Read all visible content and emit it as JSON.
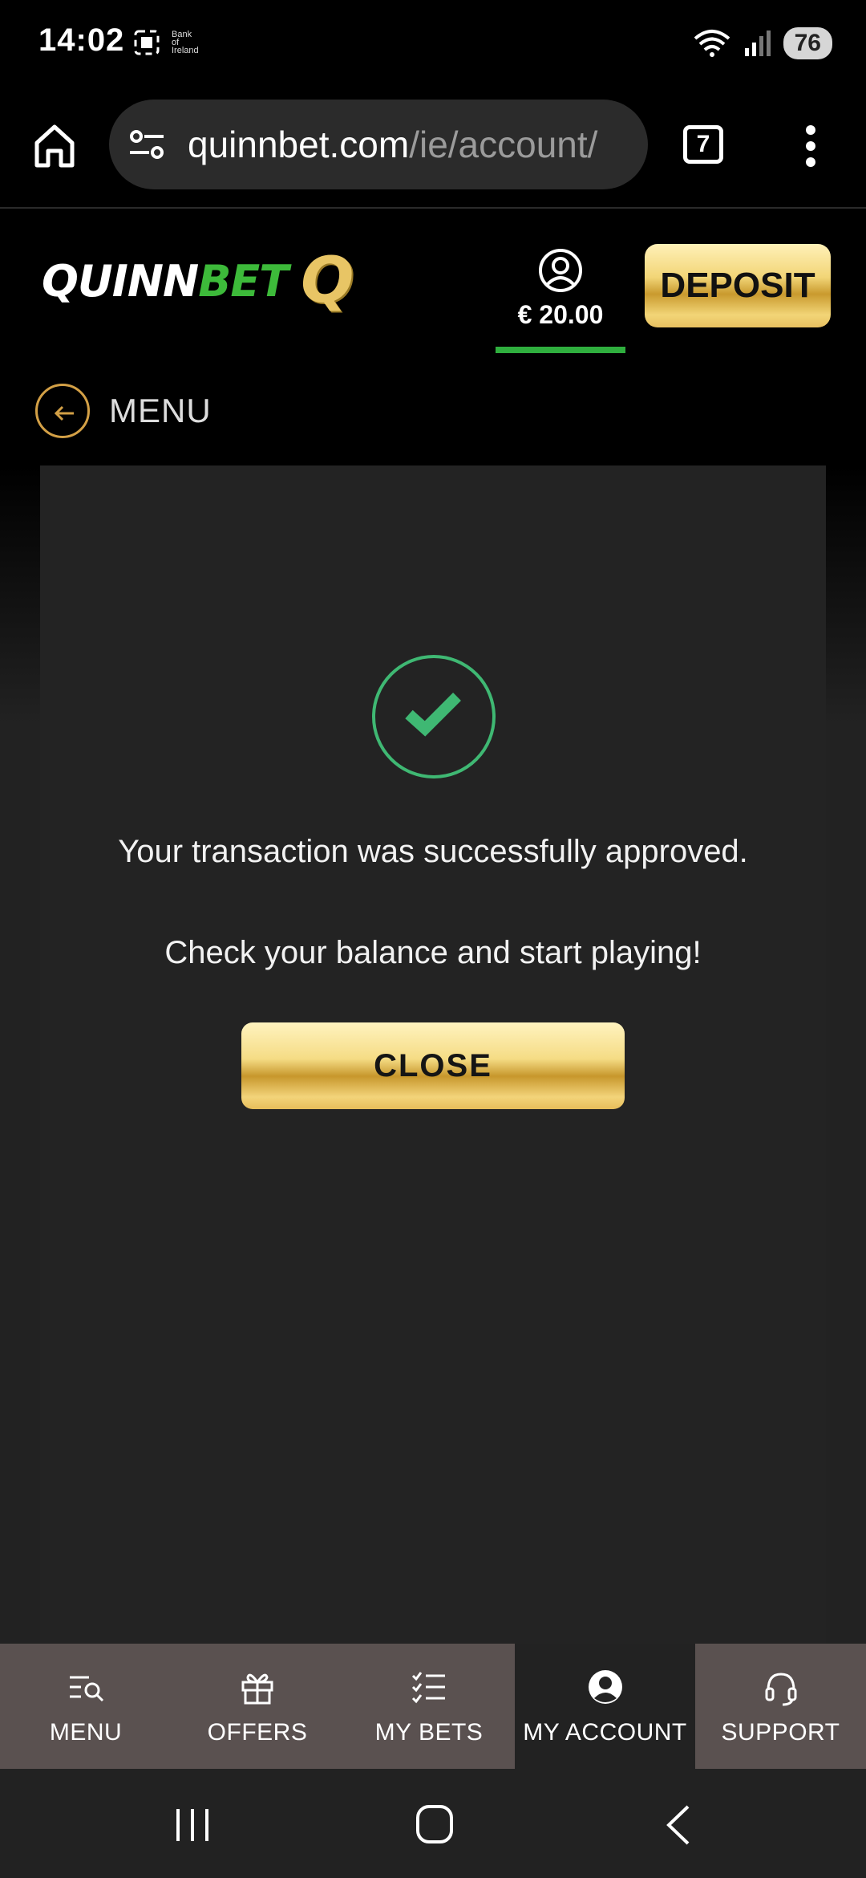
{
  "status_bar": {
    "time": "14:02",
    "bank_label": "Bank of Ireland",
    "battery": "76"
  },
  "browser": {
    "url_domain": "quinnbet.com",
    "url_path": "/ie/account/",
    "tab_count": "7"
  },
  "header": {
    "logo_quinn": "QUINN",
    "logo_bet": "BET",
    "logo_q": "Q",
    "balance": "€ 20.00",
    "deposit_label": "DEPOSIT"
  },
  "menu_row": {
    "label": "MENU"
  },
  "dialog": {
    "message_line1": "Your transaction was successfully approved.",
    "message_line2": "Check your balance and start playing!",
    "close_label": "CLOSE"
  },
  "bottom_nav": {
    "items": [
      {
        "label": "MENU",
        "icon": "menu-search-icon"
      },
      {
        "label": "OFFERS",
        "icon": "gift-icon"
      },
      {
        "label": "MY BETS",
        "icon": "checklist-icon"
      },
      {
        "label": "MY ACCOUNT",
        "icon": "account-icon"
      },
      {
        "label": "SUPPORT",
        "icon": "headset-icon"
      }
    ],
    "active_index": 3
  },
  "colors": {
    "accent_gold": "#e8c565",
    "brand_green": "#3dba3a",
    "success_green": "#3fb873",
    "nav_bg": "#5a5150"
  }
}
